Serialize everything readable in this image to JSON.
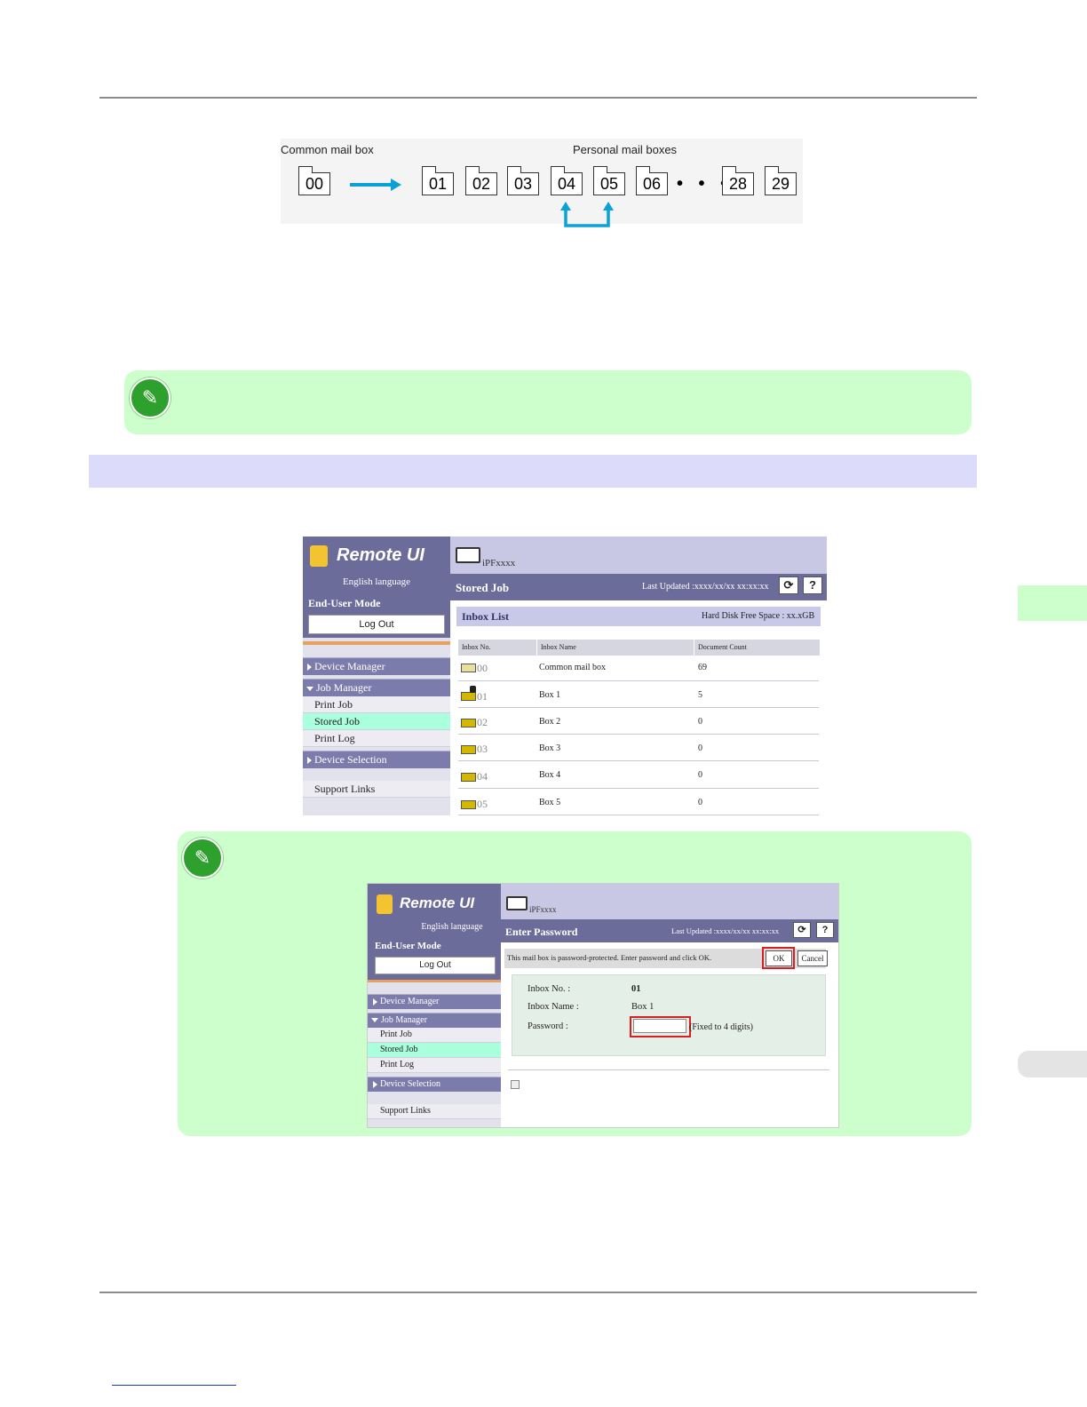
{
  "diagram": {
    "common_label": "Common mail box",
    "personal_label": "Personal mail boxes",
    "boxes": [
      "00",
      "01",
      "02",
      "03",
      "04",
      "05",
      "06",
      "28",
      "29"
    ],
    "ellipsis": "• • •"
  },
  "colors": {
    "accent_arrow": "#0aa0d8",
    "note_bg": "#ccffcc",
    "section_bg": "#dcdcfa",
    "remote_ui_purple": "#6c6c9a"
  },
  "screen1": {
    "logo": "Remote UI",
    "language": "English language",
    "mode": "End-User Mode",
    "logout": "Log Out",
    "printer": "iPFxxxx",
    "page_title": "Stored Job",
    "last_updated": "Last Updated :xxxx/xx/xx xx:xx:xx",
    "refresh_icon": "refresh-icon",
    "help": "?",
    "nav": {
      "device_manager": "Device Manager",
      "job_manager": "Job Manager",
      "print_job": "Print Job",
      "stored_job": "Stored Job",
      "print_log": "Print Log",
      "device_selection": "Device Selection",
      "support_links": "Support Links"
    },
    "inbox_title": "Inbox List",
    "free_space": "Hard Disk Free Space : xx.xGB",
    "columns": [
      "Inbox No.",
      "Inbox Name",
      "Document Count"
    ],
    "rows": [
      {
        "no": "00",
        "name": "Common mail box",
        "count": "69"
      },
      {
        "no": "01",
        "name": "Box 1",
        "count": "5"
      },
      {
        "no": "02",
        "name": "Box 2",
        "count": "0"
      },
      {
        "no": "03",
        "name": "Box 3",
        "count": "0"
      },
      {
        "no": "04",
        "name": "Box 4",
        "count": "0"
      },
      {
        "no": "05",
        "name": "Box 5",
        "count": "0"
      }
    ]
  },
  "screen2": {
    "logo": "Remote UI",
    "language": "English language",
    "mode": "End-User Mode",
    "logout": "Log Out",
    "printer": "iPFxxxx",
    "page_title": "Enter Password",
    "last_updated": "Last Updated :xxxx/xx/xx xx:xx:xx",
    "help": "?",
    "nav": {
      "device_manager": "Device Manager",
      "job_manager": "Job Manager",
      "print_job": "Print Job",
      "stored_job": "Stored Job",
      "print_log": "Print Log",
      "device_selection": "Device Selection",
      "support_links": "Support Links"
    },
    "message": "This mail box is password-protected. Enter password and click OK.",
    "ok": "OK",
    "cancel": "Cancel",
    "inbox_no_label": "Inbox No. :",
    "inbox_no_value": "01",
    "inbox_name_label": "Inbox Name :",
    "inbox_name_value": "Box 1",
    "password_label": "Password :",
    "password_value": "",
    "password_hint": "(Fixed to 4 digits)"
  }
}
